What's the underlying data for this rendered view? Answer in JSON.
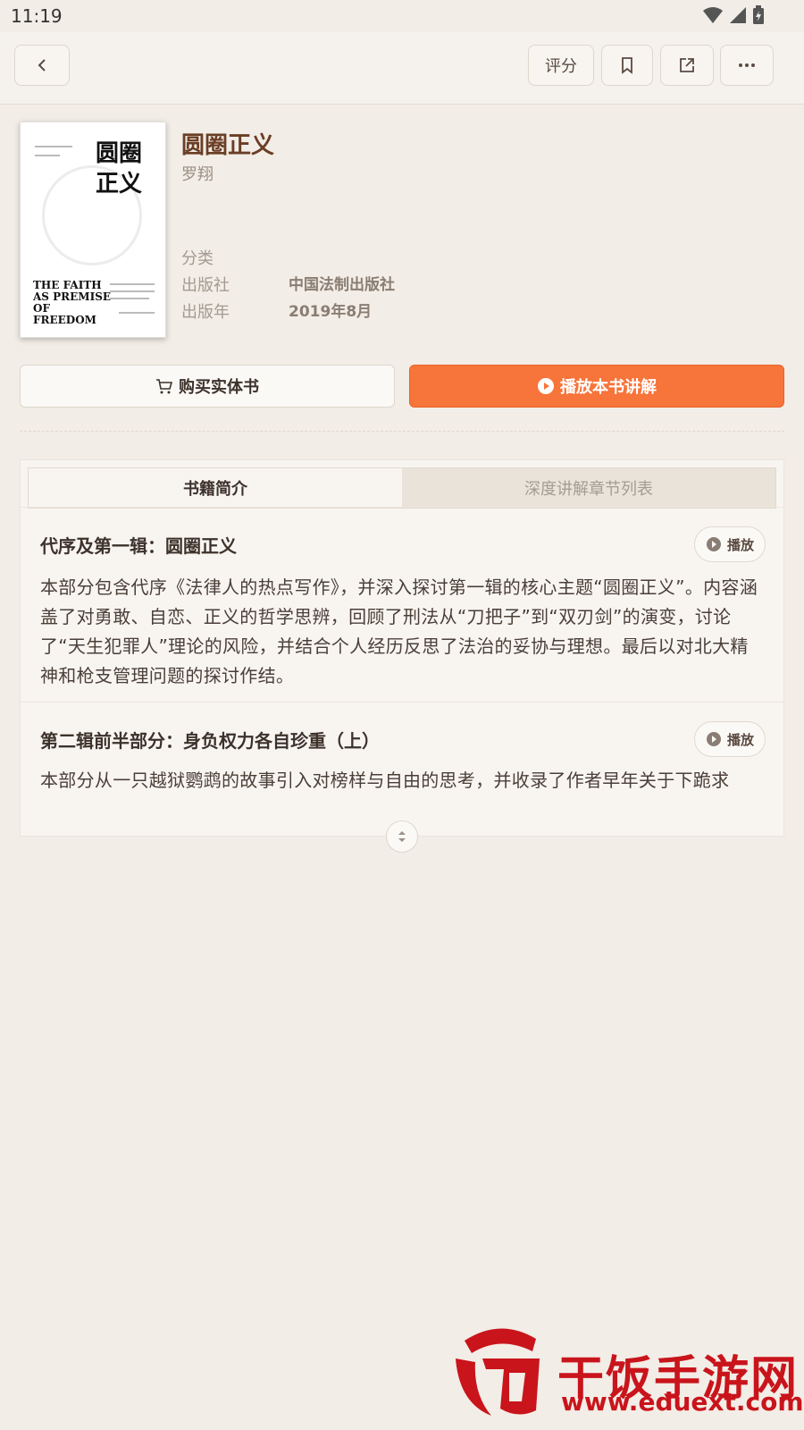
{
  "status_bar": {
    "time": "11:19"
  },
  "top_bar": {
    "rate_label": "评分"
  },
  "book": {
    "cover_title": "圆圈\n正义",
    "cover_en": "THE FAITH\nAS PREMISE\nOF FREEDOM",
    "title": "圆圈正义",
    "author": "罗翔",
    "category_label": "分类",
    "category_value": "",
    "publisher_label": "出版社",
    "publisher_value": "中国法制出版社",
    "year_label": "出版年",
    "year_value": "2019年8月"
  },
  "actions": {
    "buy_label": "购买实体书",
    "play_label": "播放本书讲解"
  },
  "tabs": [
    {
      "label": "书籍简介",
      "active": true
    },
    {
      "label": "深度讲解章节列表",
      "active": false
    }
  ],
  "sections": [
    {
      "title": "代序及第一辑：圆圈正义",
      "play_label": "播放",
      "body": "本部分包含代序《法律人的热点写作》，并深入探讨第一辑的核心主题“圆圈正义”。内容涵盖了对勇敢、自恋、正义的哲学思辨，回顾了刑法从“刀把子”到“双刃剑”的演变，讨论了“天生犯罪人”理论的风险，并结合个人经历反思了法治的妥协与理想。最后以对北大精神和枪支管理问题的探讨作结。"
    },
    {
      "title": "第二辑前半部分：身负权力各自珍重（上）",
      "play_label": "播放",
      "body": "本部分从一只越狱鹦鹉的故事引入对榜样与自由的思考，并收录了作者早年关于下跪求"
    }
  ],
  "watermark": {
    "brand": "干饭手游网",
    "url": "www.eduext.com"
  },
  "colors": {
    "accent": "#f7743a",
    "background": "#f2ede6",
    "title": "#6a3e25"
  }
}
